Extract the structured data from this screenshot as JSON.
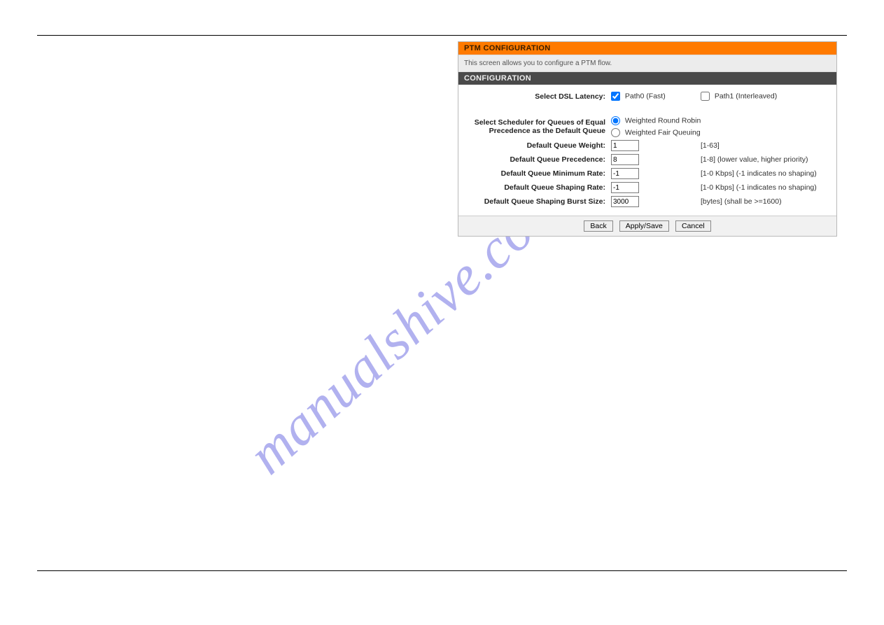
{
  "watermark": "manualshive.com",
  "panel": {
    "title": "PTM CONFIGURATION",
    "description": "This screen allows you to configure a PTM flow.",
    "section_title": "CONFIGURATION",
    "latency": {
      "label": "Select DSL Latency:",
      "path0": {
        "checked": true,
        "label": "Path0 (Fast)"
      },
      "path1": {
        "checked": false,
        "label": "Path1 (Interleaved)"
      }
    },
    "scheduler": {
      "label": "Select Scheduler for Queues of Equal Precedence as the Default Queue",
      "wrr": {
        "selected": true,
        "label": "Weighted Round Robin"
      },
      "wfq": {
        "selected": false,
        "label": "Weighted Fair Queuing"
      }
    },
    "fields": {
      "weight": {
        "label": "Default Queue Weight:",
        "value": "1",
        "hint": "[1-63]"
      },
      "prec": {
        "label": "Default Queue Precedence:",
        "value": "8",
        "hint": "[1-8] (lower value, higher priority)"
      },
      "minrate": {
        "label": "Default Queue Minimum Rate:",
        "value": "-1",
        "hint": "[1-0 Kbps] (-1 indicates no shaping)"
      },
      "shaprate": {
        "label": "Default Queue Shaping Rate:",
        "value": "-1",
        "hint": "[1-0 Kbps] (-1 indicates no shaping)"
      },
      "burst": {
        "label": "Default Queue Shaping Burst Size:",
        "value": "3000",
        "hint": "[bytes] (shall be >=1600)"
      }
    },
    "buttons": {
      "back": "Back",
      "apply": "Apply/Save",
      "cancel": "Cancel"
    }
  }
}
